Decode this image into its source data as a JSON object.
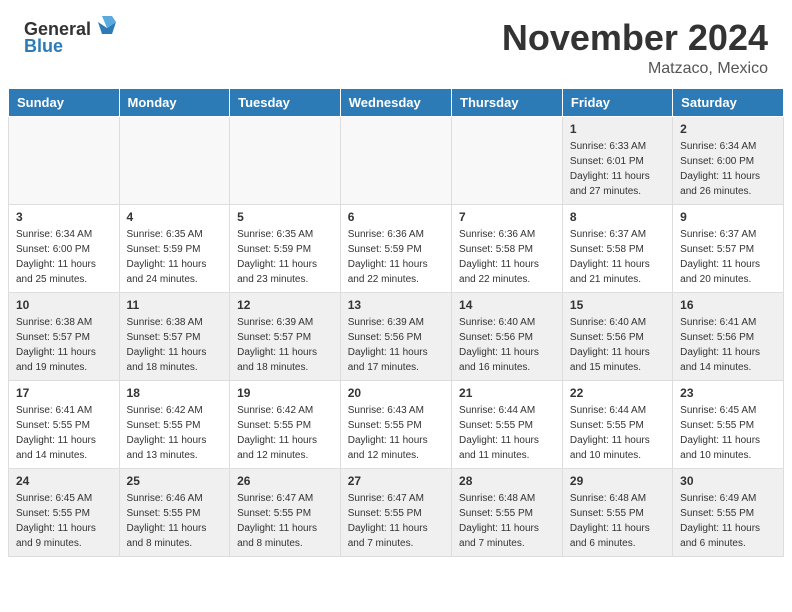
{
  "header": {
    "logo_general": "General",
    "logo_blue": "Blue",
    "month": "November 2024",
    "location": "Matzaco, Mexico"
  },
  "weekdays": [
    "Sunday",
    "Monday",
    "Tuesday",
    "Wednesday",
    "Thursday",
    "Friday",
    "Saturday"
  ],
  "weeks": [
    [
      {
        "day": "",
        "info": ""
      },
      {
        "day": "",
        "info": ""
      },
      {
        "day": "",
        "info": ""
      },
      {
        "day": "",
        "info": ""
      },
      {
        "day": "",
        "info": ""
      },
      {
        "day": "1",
        "info": "Sunrise: 6:33 AM\nSunset: 6:01 PM\nDaylight: 11 hours and 27 minutes."
      },
      {
        "day": "2",
        "info": "Sunrise: 6:34 AM\nSunset: 6:00 PM\nDaylight: 11 hours and 26 minutes."
      }
    ],
    [
      {
        "day": "3",
        "info": "Sunrise: 6:34 AM\nSunset: 6:00 PM\nDaylight: 11 hours and 25 minutes."
      },
      {
        "day": "4",
        "info": "Sunrise: 6:35 AM\nSunset: 5:59 PM\nDaylight: 11 hours and 24 minutes."
      },
      {
        "day": "5",
        "info": "Sunrise: 6:35 AM\nSunset: 5:59 PM\nDaylight: 11 hours and 23 minutes."
      },
      {
        "day": "6",
        "info": "Sunrise: 6:36 AM\nSunset: 5:59 PM\nDaylight: 11 hours and 22 minutes."
      },
      {
        "day": "7",
        "info": "Sunrise: 6:36 AM\nSunset: 5:58 PM\nDaylight: 11 hours and 22 minutes."
      },
      {
        "day": "8",
        "info": "Sunrise: 6:37 AM\nSunset: 5:58 PM\nDaylight: 11 hours and 21 minutes."
      },
      {
        "day": "9",
        "info": "Sunrise: 6:37 AM\nSunset: 5:57 PM\nDaylight: 11 hours and 20 minutes."
      }
    ],
    [
      {
        "day": "10",
        "info": "Sunrise: 6:38 AM\nSunset: 5:57 PM\nDaylight: 11 hours and 19 minutes."
      },
      {
        "day": "11",
        "info": "Sunrise: 6:38 AM\nSunset: 5:57 PM\nDaylight: 11 hours and 18 minutes."
      },
      {
        "day": "12",
        "info": "Sunrise: 6:39 AM\nSunset: 5:57 PM\nDaylight: 11 hours and 18 minutes."
      },
      {
        "day": "13",
        "info": "Sunrise: 6:39 AM\nSunset: 5:56 PM\nDaylight: 11 hours and 17 minutes."
      },
      {
        "day": "14",
        "info": "Sunrise: 6:40 AM\nSunset: 5:56 PM\nDaylight: 11 hours and 16 minutes."
      },
      {
        "day": "15",
        "info": "Sunrise: 6:40 AM\nSunset: 5:56 PM\nDaylight: 11 hours and 15 minutes."
      },
      {
        "day": "16",
        "info": "Sunrise: 6:41 AM\nSunset: 5:56 PM\nDaylight: 11 hours and 14 minutes."
      }
    ],
    [
      {
        "day": "17",
        "info": "Sunrise: 6:41 AM\nSunset: 5:55 PM\nDaylight: 11 hours and 14 minutes."
      },
      {
        "day": "18",
        "info": "Sunrise: 6:42 AM\nSunset: 5:55 PM\nDaylight: 11 hours and 13 minutes."
      },
      {
        "day": "19",
        "info": "Sunrise: 6:42 AM\nSunset: 5:55 PM\nDaylight: 11 hours and 12 minutes."
      },
      {
        "day": "20",
        "info": "Sunrise: 6:43 AM\nSunset: 5:55 PM\nDaylight: 11 hours and 12 minutes."
      },
      {
        "day": "21",
        "info": "Sunrise: 6:44 AM\nSunset: 5:55 PM\nDaylight: 11 hours and 11 minutes."
      },
      {
        "day": "22",
        "info": "Sunrise: 6:44 AM\nSunset: 5:55 PM\nDaylight: 11 hours and 10 minutes."
      },
      {
        "day": "23",
        "info": "Sunrise: 6:45 AM\nSunset: 5:55 PM\nDaylight: 11 hours and 10 minutes."
      }
    ],
    [
      {
        "day": "24",
        "info": "Sunrise: 6:45 AM\nSunset: 5:55 PM\nDaylight: 11 hours and 9 minutes."
      },
      {
        "day": "25",
        "info": "Sunrise: 6:46 AM\nSunset: 5:55 PM\nDaylight: 11 hours and 8 minutes."
      },
      {
        "day": "26",
        "info": "Sunrise: 6:47 AM\nSunset: 5:55 PM\nDaylight: 11 hours and 8 minutes."
      },
      {
        "day": "27",
        "info": "Sunrise: 6:47 AM\nSunset: 5:55 PM\nDaylight: 11 hours and 7 minutes."
      },
      {
        "day": "28",
        "info": "Sunrise: 6:48 AM\nSunset: 5:55 PM\nDaylight: 11 hours and 7 minutes."
      },
      {
        "day": "29",
        "info": "Sunrise: 6:48 AM\nSunset: 5:55 PM\nDaylight: 11 hours and 6 minutes."
      },
      {
        "day": "30",
        "info": "Sunrise: 6:49 AM\nSunset: 5:55 PM\nDaylight: 11 hours and 6 minutes."
      }
    ]
  ]
}
